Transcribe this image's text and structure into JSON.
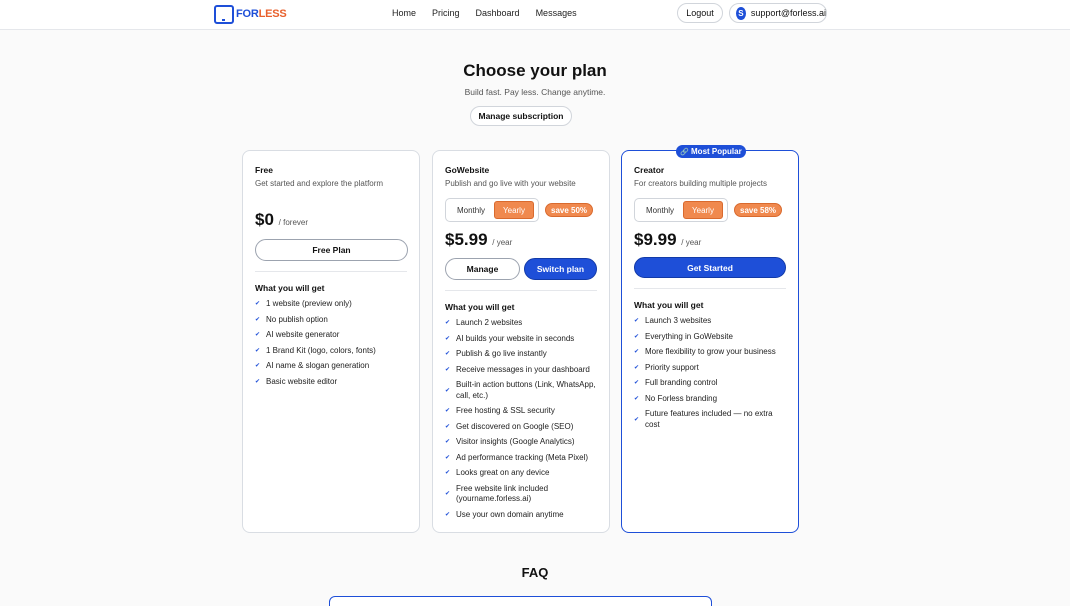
{
  "header": {
    "logo_for": "FOR",
    "logo_less": "LESS",
    "nav": [
      "Home",
      "Pricing",
      "Dashboard",
      "Messages"
    ],
    "logout": "Logout",
    "avatar_letter": "S",
    "account_email": "support@forless.ai"
  },
  "hero": {
    "title": "Choose your plan",
    "subtitle": "Build fast. Pay less. Change anytime.",
    "manage_subscription": "Manage subscription"
  },
  "plans": [
    {
      "name": "Free",
      "description": "Get started and explore the platform",
      "price": "$0",
      "period": "/ forever",
      "buttons": [
        "Free Plan"
      ],
      "features_title": "What you will get",
      "features": [
        "1 website (preview only)",
        "No publish option",
        "AI website generator",
        "1 Brand Kit (logo, colors, fonts)",
        "AI name & slogan generation",
        "Basic website editor"
      ]
    },
    {
      "name": "GoWebsite",
      "description": "Publish and go live with your website",
      "toggle": {
        "monthly": "Monthly",
        "yearly": "Yearly"
      },
      "save": "save 50%",
      "price": "$5.99",
      "period": "/ year",
      "buttons": [
        "Manage",
        "Switch plan"
      ],
      "features_title": "What you will get",
      "features": [
        "Launch 2 websites",
        "AI builds your website in seconds",
        "Publish & go live instantly",
        "Receive messages in your dashboard",
        "Built-in action buttons (Link, WhatsApp, call, etc.)",
        "Free hosting & SSL security",
        "Get discovered on Google (SEO)",
        "Visitor insights (Google Analytics)",
        "Ad performance tracking (Meta Pixel)",
        "Looks great on any device",
        "Free website link included (yourname.forless.ai)",
        "Use your own domain anytime"
      ]
    },
    {
      "name": "Creator",
      "badge": "Most Popular",
      "description": "For creators building multiple projects",
      "toggle": {
        "monthly": "Monthly",
        "yearly": "Yearly"
      },
      "save": "save 58%",
      "price": "$9.99",
      "period": "/ year",
      "buttons": [
        "Get Started"
      ],
      "features_title": "What you will get",
      "features": [
        "Launch 3 websites",
        "Everything in GoWebsite",
        "More flexibility to grow your business",
        "Priority support",
        "Full branding control",
        "No Forless branding",
        "Future features included — no extra cost"
      ]
    }
  ],
  "faq": {
    "title": "FAQ"
  },
  "colors": {
    "accent": "#1e4fd8",
    "orange": "#f0894e"
  },
  "icons": {
    "check": "check-icon",
    "logo": "logo-icon",
    "badge": "link-icon"
  }
}
